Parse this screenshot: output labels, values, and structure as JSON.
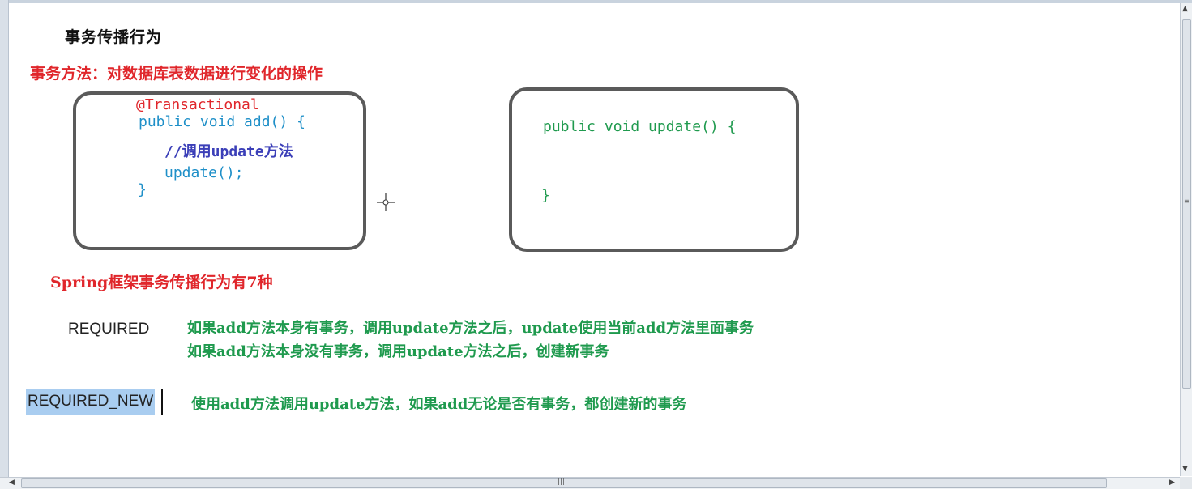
{
  "slide": {
    "title": "事务传播行为",
    "subtitle": "事务方法：对数据库表数据进行变化的操作"
  },
  "code_left": {
    "annotation": "@Transactional",
    "signature": "public void add() {",
    "comment": "//调用update方法",
    "call": "update();",
    "close": "}"
  },
  "code_right": {
    "signature": "public void update() {",
    "close": "}"
  },
  "section": {
    "heading": "Spring框架事务传播行为有7种"
  },
  "propagation": [
    {
      "name": "REQUIRED",
      "lines": [
        "如果add方法本身有事务，调用update方法之后，update使用当前add方法里面事务",
        "如果add方法本身没有事务，调用update方法之后，创建新事务"
      ]
    },
    {
      "name": "REQUIRED_NEW",
      "lines": [
        "使用add方法调用update方法，如果add无论是否有事务，都创建新的事务"
      ]
    }
  ],
  "icons": {
    "cursor": "crosshair-cursor-icon",
    "scroll_up": "arrow-up-icon",
    "scroll_down": "arrow-down-icon",
    "scroll_left": "arrow-left-icon",
    "scroll_right": "arrow-right-icon"
  },
  "colors": {
    "red": "#e0262b",
    "blue": "#1e8fc8",
    "green": "#1f9a4e",
    "selection": "#a9cdf0"
  }
}
